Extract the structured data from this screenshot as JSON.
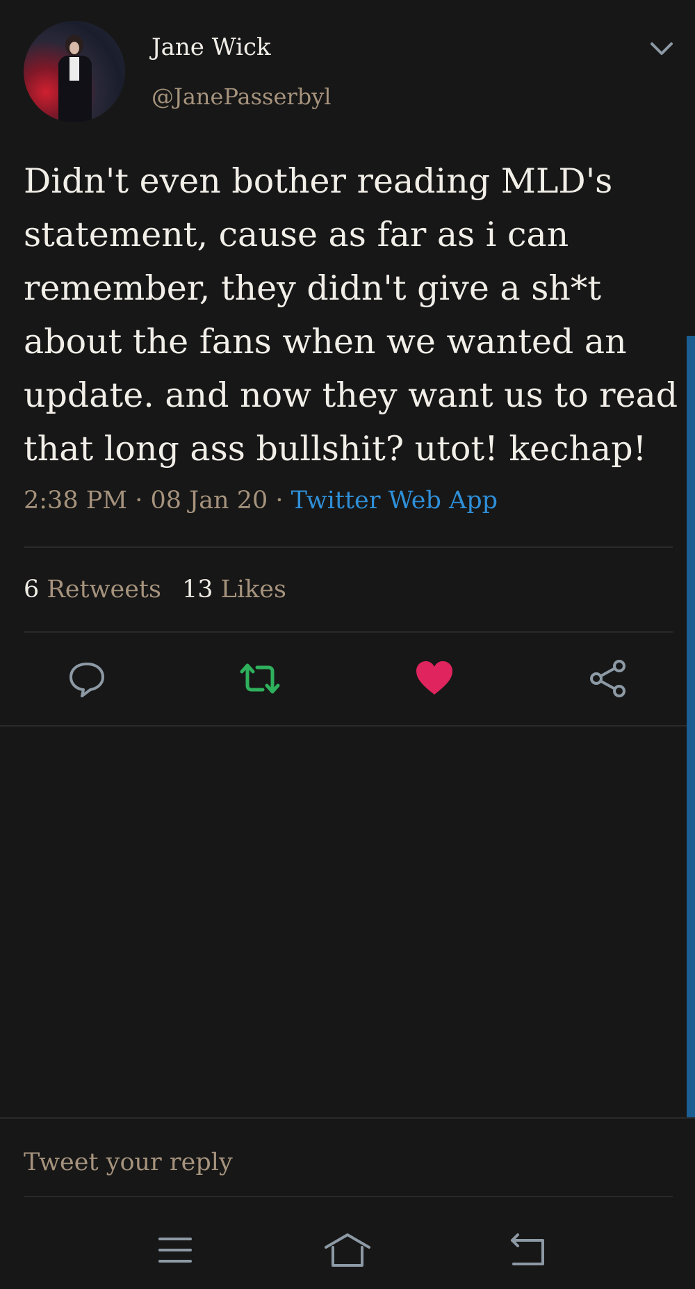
{
  "tweet": {
    "display_name": "Jane Wick",
    "handle": "@JanePasserbyl",
    "text": "Didn't even bother reading MLD's statement, cause as far as i can remember, they didn't give a sh*t about the fans when we wanted an update. and now they want us to read that long ass bullshit? utot! kechap!",
    "time": "2:38 PM",
    "separator": " · ",
    "date": "08 Jan 20",
    "source": "Twitter Web App"
  },
  "stats": {
    "retweets_count": "6",
    "retweets_label": "Retweets",
    "likes_count": "13",
    "likes_label": "Likes"
  },
  "actions": {
    "reply_icon": "reply-icon",
    "retweet_icon": "retweet-icon",
    "like_icon": "heart-icon",
    "share_icon": "share-icon",
    "retweet_color": "#2fb05c",
    "like_color": "#e0245e"
  },
  "reply_box": {
    "placeholder": "Tweet your reply"
  },
  "navbar": {
    "icons": [
      "menu-icon",
      "home-icon",
      "back-icon"
    ]
  },
  "colors": {
    "background": "#171717",
    "accent_link": "#2f8fd8",
    "muted_text": "#a6937d",
    "scroll_indicator": "#1b5f92"
  }
}
